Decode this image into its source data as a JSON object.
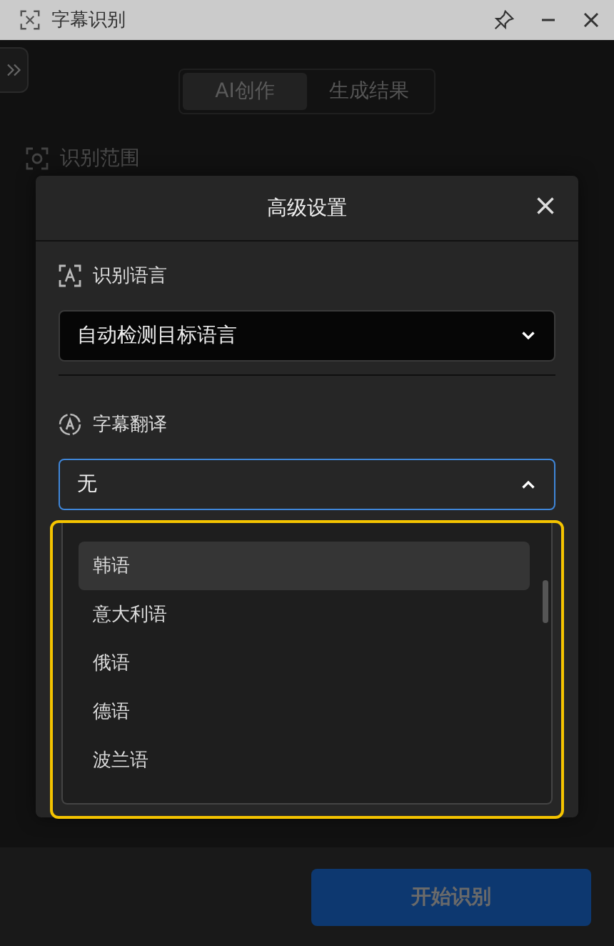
{
  "window": {
    "title": "字幕识别"
  },
  "tabs": [
    {
      "label": "AI创作",
      "selected": true
    },
    {
      "label": "生成结果",
      "selected": false
    }
  ],
  "background_section": {
    "label": "识别范围"
  },
  "start_button": {
    "label": "开始识别"
  },
  "dialog": {
    "title": "高级设置",
    "fields": [
      {
        "label": "识别语言",
        "value": "自动检测目标语言",
        "expanded": false
      },
      {
        "label": "字幕翻译",
        "value": "无",
        "expanded": true,
        "options": [
          {
            "label": "韩语",
            "selected": true
          },
          {
            "label": "意大利语",
            "selected": false
          },
          {
            "label": "俄语",
            "selected": false
          },
          {
            "label": "德语",
            "selected": false
          },
          {
            "label": "波兰语",
            "selected": false
          }
        ]
      }
    ]
  }
}
